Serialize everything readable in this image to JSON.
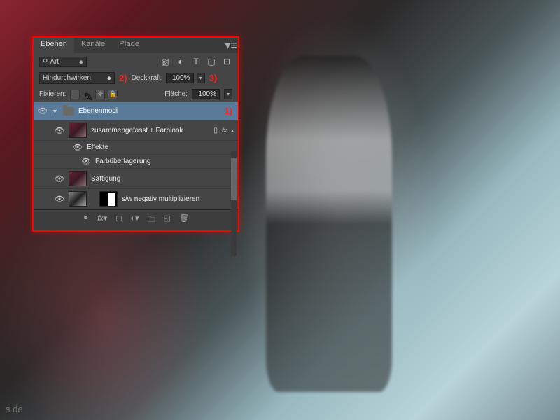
{
  "tabs": {
    "layers": "Ebenen",
    "channels": "Kanäle",
    "paths": "Pfade"
  },
  "filter": {
    "label": "Art",
    "search_icon": "⚲"
  },
  "blend": {
    "mode": "Hindurchwirken",
    "opacity_label": "Deckkraft:",
    "opacity_value": "100%",
    "fill_label": "Fläche:",
    "fill_value": "100%"
  },
  "lock": {
    "label": "Fixieren:"
  },
  "annotations": {
    "a1": "1)",
    "a2": "2)",
    "a3": "3)"
  },
  "layers": {
    "group": "Ebenenmodi",
    "l1": "zusammengefasst + Farblook",
    "fx": "fx",
    "effects": "Effekte",
    "effect1": "Farbüberlagerung",
    "l2": "Sättigung",
    "l3": "s/w negativ multiplizieren"
  },
  "watermark": "s.de"
}
